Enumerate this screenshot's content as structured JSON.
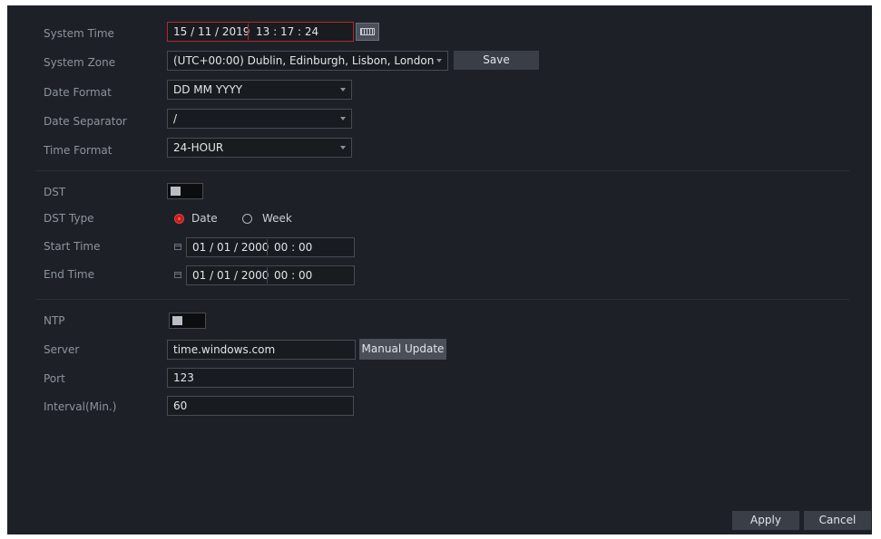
{
  "labels": {
    "system_time": "System Time",
    "system_zone": "System Zone",
    "date_format": "Date Format",
    "date_separator": "Date Separator",
    "time_format": "Time Format",
    "dst": "DST",
    "dst_type": "DST Type",
    "start_time": "Start Time",
    "end_time": "End Time",
    "ntp": "NTP",
    "server": "Server",
    "port": "Port",
    "interval": "Interval(Min.)"
  },
  "system_time": {
    "date": "15 / 11 / 2019",
    "time": "13 : 17 : 24"
  },
  "system_zone": {
    "value": "(UTC+00:00) Dublin, Edinburgh, Lisbon, London"
  },
  "date_format": {
    "value": "DD MM YYYY"
  },
  "date_separator": {
    "value": "/"
  },
  "time_format": {
    "value": "24-HOUR"
  },
  "dst": {
    "enabled": false
  },
  "dst_type": {
    "options": [
      "Date",
      "Week"
    ],
    "selected": "Date"
  },
  "start_time": {
    "date": "01 / 01 / 2000",
    "time": "00 : 00"
  },
  "end_time": {
    "date": "01 / 01 / 2000",
    "time": "00 : 00"
  },
  "ntp": {
    "enabled": false
  },
  "server": {
    "value": "time.windows.com"
  },
  "port": {
    "value": "123"
  },
  "interval": {
    "value": "60"
  },
  "buttons": {
    "save": "Save",
    "manual_update": "Manual Update",
    "apply": "Apply",
    "cancel": "Cancel"
  },
  "colors": {
    "panel_bg": "#1d2127",
    "accent_red": "#c11f1f",
    "button_bg": "#3a3f47"
  }
}
